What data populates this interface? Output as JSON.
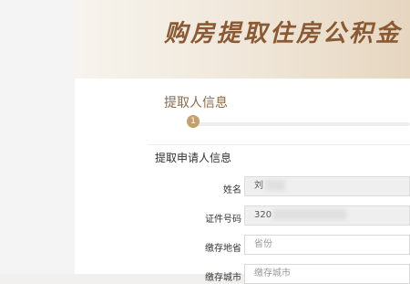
{
  "banner": {
    "title": "购房提取住房公积金"
  },
  "step": {
    "title": "提取人信息",
    "number": "1"
  },
  "form": {
    "section_title": "提取申请人信息",
    "fields": [
      {
        "label": "姓名",
        "value": "刘"
      },
      {
        "label": "证件号码",
        "value": "320"
      },
      {
        "label": "缴存地省",
        "placeholder": "省份"
      },
      {
        "label": "缴存城市",
        "placeholder": "缴存城市"
      }
    ]
  },
  "colors": {
    "accent": "#c4a06c",
    "title_brown": "#8a5a35"
  }
}
